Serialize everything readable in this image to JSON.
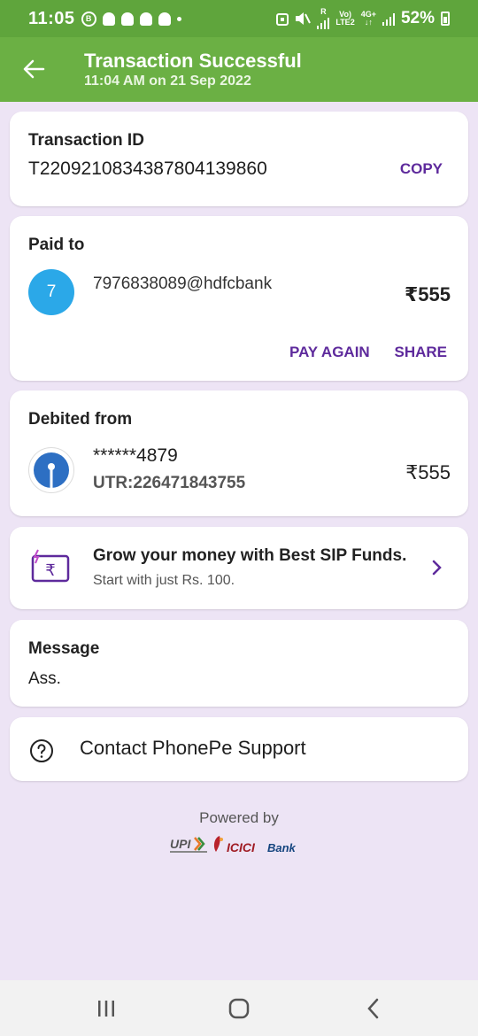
{
  "status_bar": {
    "time": "11:05",
    "b_icon": "B",
    "network_r": "R",
    "volte_top": "Vo)",
    "volte_bottom": "LTE2",
    "net_type": "4G+",
    "battery": "52%"
  },
  "header": {
    "title": "Transaction Successful",
    "subtitle": "11:04 AM on 21 Sep 2022",
    "back_icon": "arrow-left-icon",
    "color": "#6bb044"
  },
  "transaction": {
    "label": "Transaction ID",
    "id": "T2209210834387804139860",
    "copy_label": "COPY"
  },
  "paid_to": {
    "label": "Paid to",
    "avatar_initial": "7",
    "upi_id": "7976838089@hdfcbank",
    "amount": "₹555",
    "pay_again_label": "PAY AGAIN",
    "share_label": "SHARE"
  },
  "debited_from": {
    "label": "Debited from",
    "account": "******4879",
    "utr": "UTR:226471843755",
    "amount": "₹555"
  },
  "promo": {
    "title": "Grow your money with Best SIP Funds.",
    "subtitle": "Start with just Rs. 100."
  },
  "message": {
    "label": "Message",
    "text": "Ass."
  },
  "support": {
    "label": "Contact PhonePe Support",
    "icon": "help-circle-icon"
  },
  "footer": {
    "powered_by": "Powered by"
  },
  "colors": {
    "accent_purple": "#5e2a9c",
    "status_green": "#5fa53c",
    "background": "#ede4f5"
  }
}
